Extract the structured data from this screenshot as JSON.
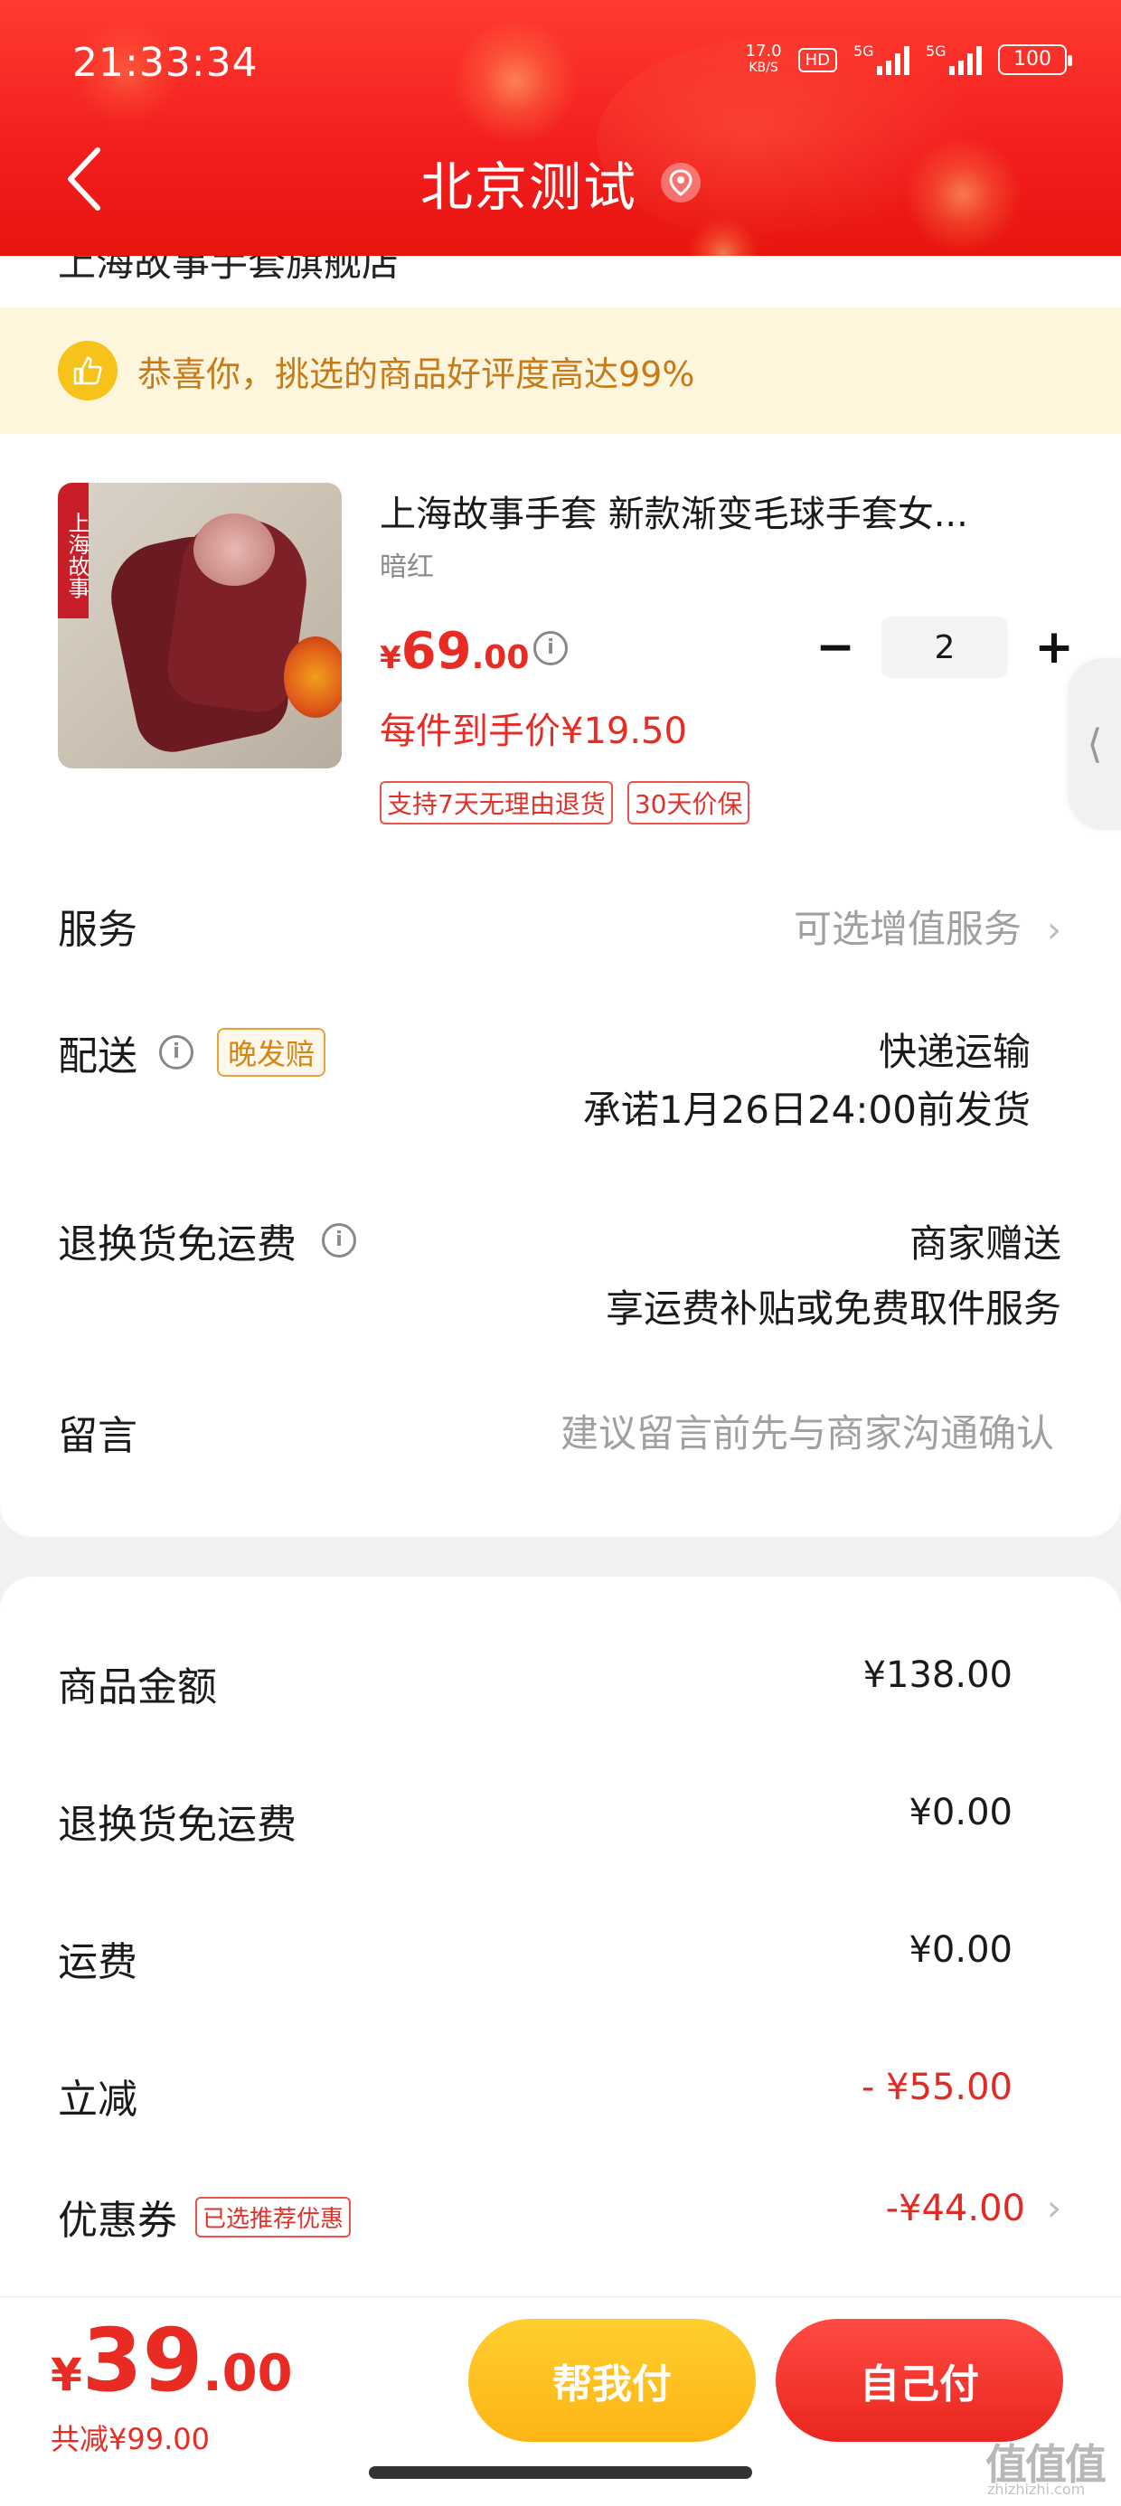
{
  "status_bar": {
    "time": "21:33:34",
    "net_speed_value": "17.0",
    "net_speed_unit": "KB/S",
    "hd_label": "HD",
    "sim1_label": "5G",
    "sim2_label": "5G",
    "battery": "100"
  },
  "header": {
    "title": "北京测试",
    "back_icon": "chevron-left-icon",
    "location_icon": "location-pin-icon"
  },
  "store": {
    "name_partial": "上海故事手套旗舰店"
  },
  "banner": {
    "icon": "thumbs-up-icon",
    "text": "恭喜你，挑选的商品好评度高达99%"
  },
  "product": {
    "title": "上海故事手套  新款渐变毛球手套女...",
    "variant": "暗红",
    "brand_strip": "上海故事",
    "price_currency": "¥",
    "price_int": "69",
    "price_dec": ".00",
    "quantity": "2",
    "unit_price": "每件到手价¥19.50",
    "tags": [
      "支持7天无理由退货",
      "30天价保"
    ]
  },
  "service": {
    "label": "服务",
    "value": "可选增值服务"
  },
  "delivery": {
    "label": "配送",
    "badge": "晚发赔",
    "method": "快递运输",
    "promise": "承诺1月26日24:00前发货"
  },
  "return_shipping": {
    "label": "退换货免运费",
    "value": "商家赠送",
    "desc": "享运费补贴或免费取件服务"
  },
  "message": {
    "label": "留言",
    "placeholder": "建议留言前先与商家沟通确认"
  },
  "fees": {
    "goods_label": "商品金额",
    "goods_value": "¥138.00",
    "return_label": "退换货免运费",
    "return_value": "¥0.00",
    "shipping_label": "运费",
    "shipping_value": "¥0.00",
    "discount_label": "立减",
    "discount_value": "- ¥55.00",
    "coupon_label": "优惠券",
    "coupon_badge": "已选推荐优惠",
    "coupon_value": "-¥44.00"
  },
  "bottom": {
    "total_currency": "¥",
    "total_int": "39",
    "total_dec": ".00",
    "saved": "共减¥99.00",
    "help_pay": "帮我付",
    "self_pay": "自己付"
  },
  "watermark": {
    "text": "值值值",
    "sub": "zhizhizhi.com"
  },
  "colors": {
    "header_red": "#f21d1d",
    "price_red": "#e82b23",
    "banner_bg": "#fdf6dd",
    "banner_text": "#c77a17",
    "help_btn": "#fdb515",
    "self_btn": "#e8261f"
  }
}
